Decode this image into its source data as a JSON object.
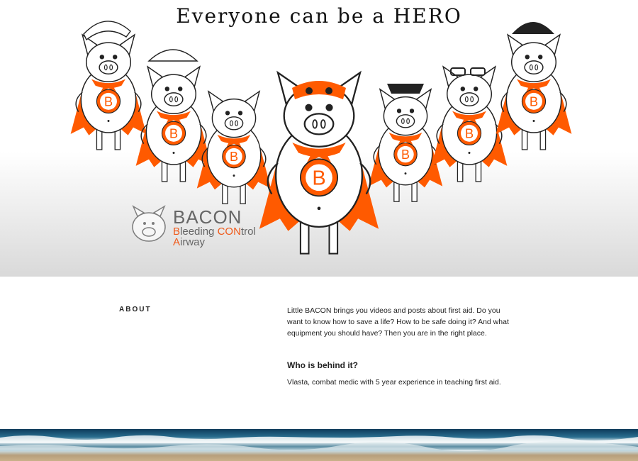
{
  "hero": {
    "title": "Everyone can be a HERO",
    "logo": {
      "name_big": "BACON",
      "line1_prefix": "B",
      "line1_rest": "leeding ",
      "line1_con": "CON",
      "line1_trol": "trol",
      "line2_prefix": "A",
      "line2_rest": "irway"
    },
    "badge_letter": "B",
    "colors": {
      "cape": "#ff5a00",
      "outline": "#222222",
      "logo_accent": "#f05a1a"
    }
  },
  "about": {
    "heading": "ABOUT",
    "intro": "Little BACON brings you videos and posts about first aid. Do you want to know how to save a life? How to be safe doing it? And what equipment you should have? Then you are in the right place.",
    "who_heading": "Who is behind it?",
    "who_text": "Vlasta, combat medic with 5 year experience in teaching first aid."
  },
  "footer": {
    "image": "beach-waves"
  }
}
